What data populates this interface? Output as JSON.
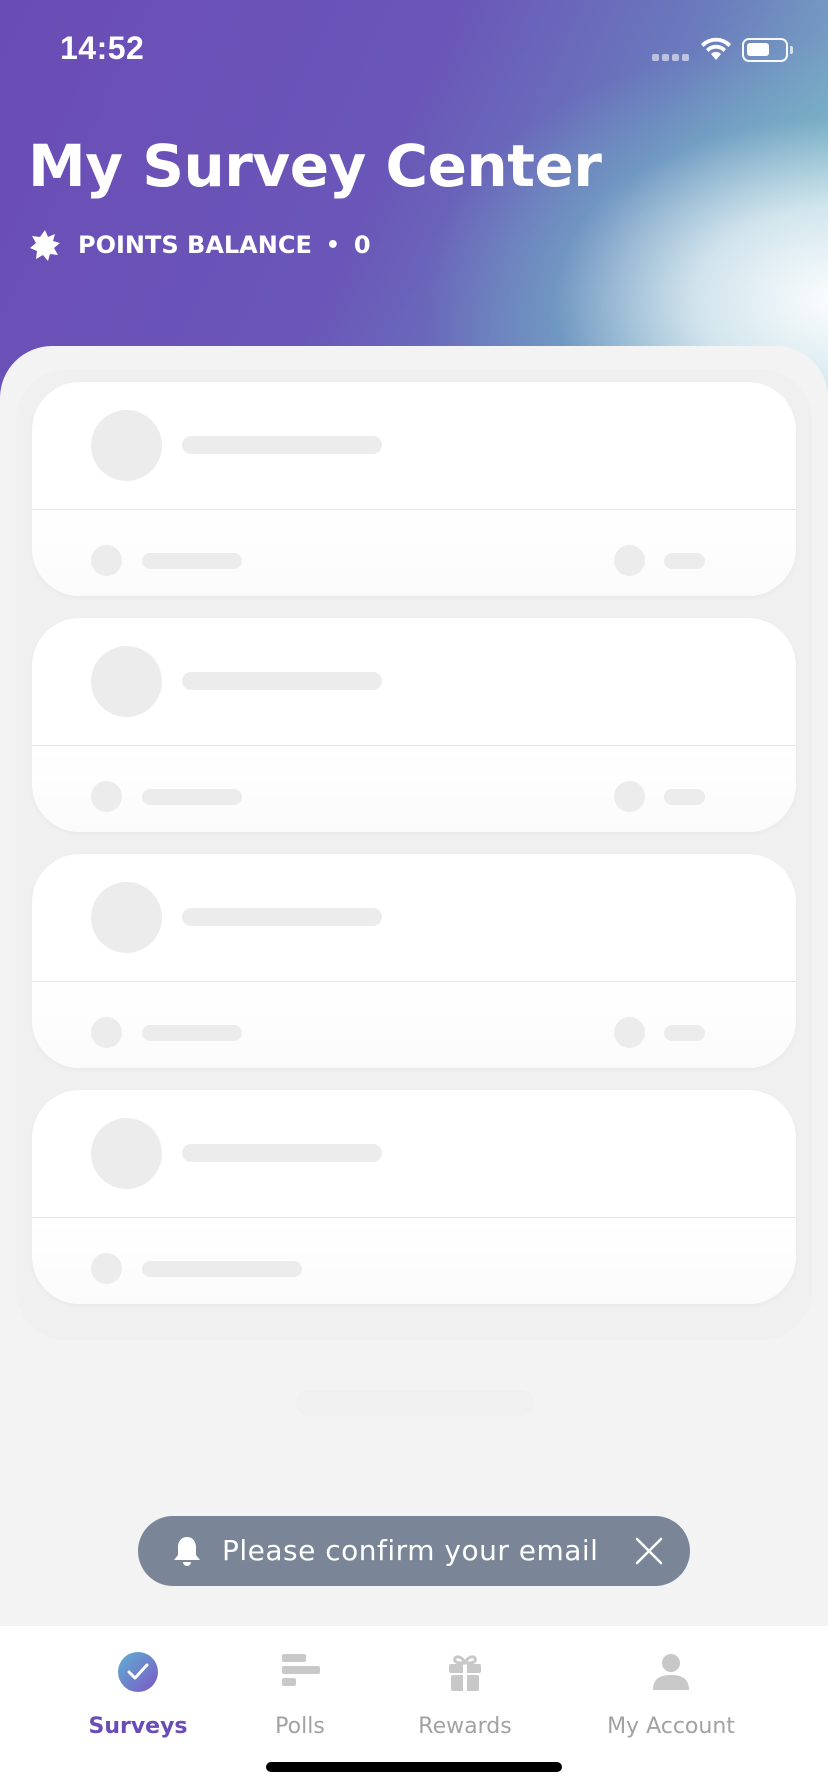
{
  "status_bar": {
    "time": "14:52"
  },
  "header": {
    "title": "My Survey Center",
    "points_label": "POINTS BALANCE",
    "points_separator": "•",
    "points_value": "0"
  },
  "cards": [
    {
      "has_right_meta": true
    },
    {
      "has_right_meta": true
    },
    {
      "has_right_meta": true
    },
    {
      "has_right_meta": false
    }
  ],
  "toast": {
    "message": "Please confirm your email",
    "icon": "bell-icon"
  },
  "nav": {
    "items": [
      {
        "label": "Surveys",
        "icon": "check-circle-icon",
        "active": true
      },
      {
        "label": "Polls",
        "icon": "bar-chart-icon",
        "active": false
      },
      {
        "label": "Rewards",
        "icon": "gift-icon",
        "active": false
      },
      {
        "label": "My Account",
        "icon": "person-icon",
        "active": false
      }
    ]
  },
  "colors": {
    "brand_purple": "#6a4cb6",
    "toast_bg": "#7a8598",
    "inactive": "#a2a2a2",
    "skeleton": "#ececec"
  }
}
